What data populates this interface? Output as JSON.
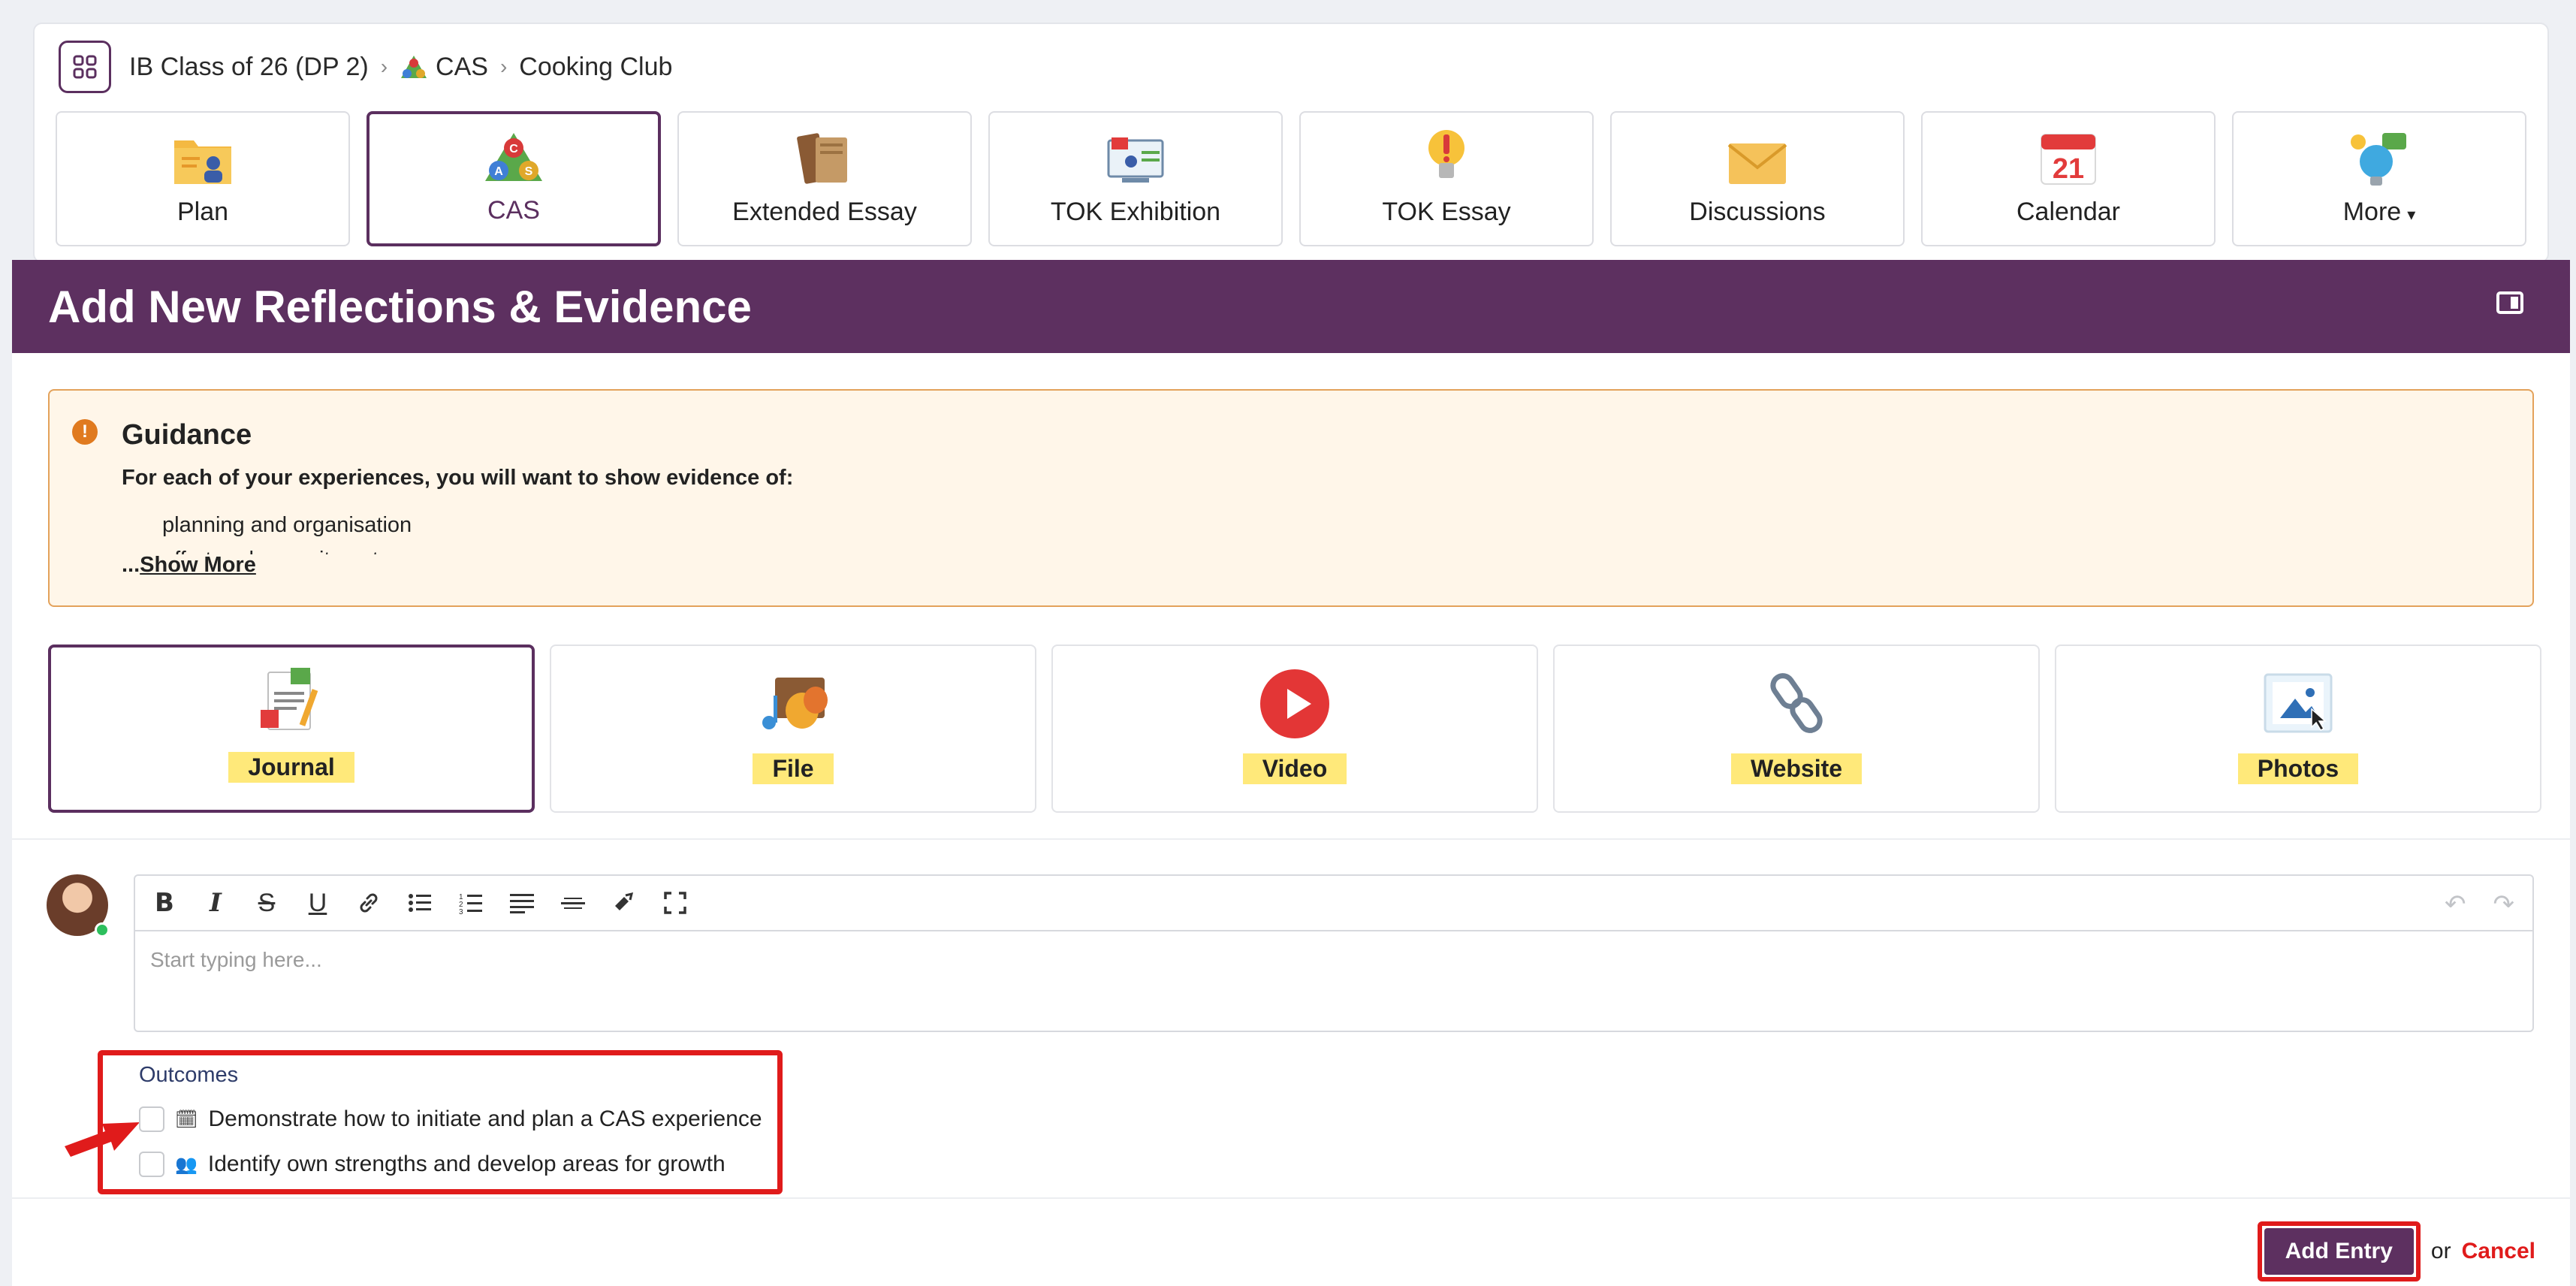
{
  "breadcrumb": {
    "class_name": "IB Class of 26 (DP 2)",
    "section": "CAS",
    "activity": "Cooking Club"
  },
  "tiles": [
    {
      "label": "Plan",
      "icon": "plan-icon"
    },
    {
      "label": "CAS",
      "icon": "cas-icon",
      "active": true
    },
    {
      "label": "Extended Essay",
      "icon": "books-icon"
    },
    {
      "label": "TOK Exhibition",
      "icon": "exhibition-icon"
    },
    {
      "label": "TOK Essay",
      "icon": "lightbulb-icon"
    },
    {
      "label": "Discussions",
      "icon": "envelope-icon"
    },
    {
      "label": "Calendar",
      "icon": "calendar-icon",
      "calendar_day": "21"
    },
    {
      "label": "More",
      "icon": "ideas-icon"
    }
  ],
  "header": {
    "title": "Add New Reflections & Evidence"
  },
  "guidance": {
    "title": "Guidance",
    "subtitle": "For each of your experiences, you will want to show evidence of:",
    "items": [
      "planning and organisation",
      "effort and commitment"
    ],
    "more_prefix": "...",
    "more_link": "Show More"
  },
  "entry_types": [
    {
      "label": "Journal",
      "icon": "journal-icon",
      "active": true
    },
    {
      "label": "File",
      "icon": "file-icon"
    },
    {
      "label": "Video",
      "icon": "video-icon"
    },
    {
      "label": "Website",
      "icon": "link-icon"
    },
    {
      "label": "Photos",
      "icon": "photos-icon"
    }
  ],
  "editor": {
    "placeholder": "Start typing here..."
  },
  "outcomes": {
    "title": "Outcomes",
    "items": [
      {
        "label": "Demonstrate how to initiate and plan a CAS experience",
        "checked": false
      },
      {
        "label": "Identify own strengths and develop areas for growth",
        "checked": false
      }
    ]
  },
  "actions": {
    "add_label": "Add Entry",
    "or_text": "or",
    "cancel_label": "Cancel"
  },
  "colors": {
    "brand_purple": "#5d3060",
    "highlight": "#ffe97a",
    "guidance_bg": "#fff6e9",
    "annotation_red": "#e01b1b"
  }
}
